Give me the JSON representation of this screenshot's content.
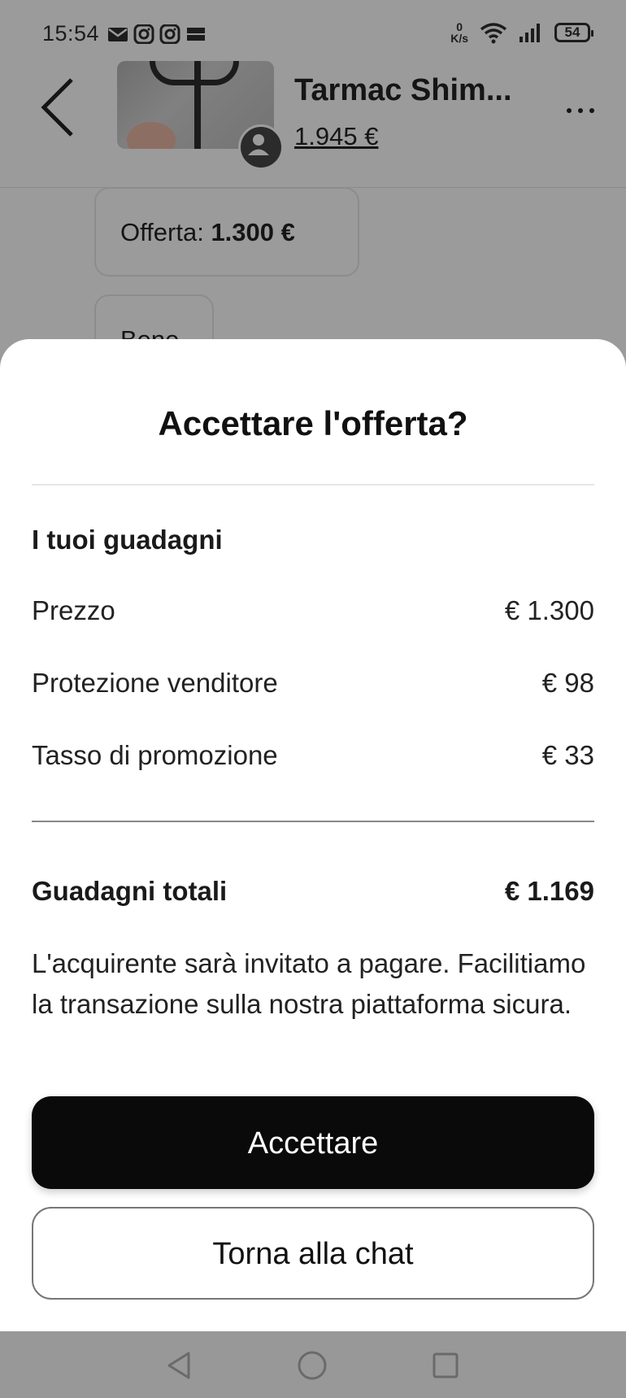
{
  "status_bar": {
    "time": "15:54",
    "notification_icons": [
      "mail-icon",
      "instagram-icon",
      "instagram-icon",
      "temu-icon"
    ],
    "network_speed_value": "0",
    "network_speed_unit": "K/s",
    "battery": "54"
  },
  "chat_header": {
    "title": "Tarmac Shim...",
    "price": "1.945 €",
    "back_icon": "chevron-left-icon",
    "more_icon": "ellipsis-icon"
  },
  "chat": {
    "offer_label": "Offerta:",
    "offer_amount": "1.300 €",
    "partial_message": "Bene"
  },
  "sheet": {
    "title": "Accettare l'offerta?",
    "section_title": "I tuoi guadagni",
    "rows": [
      {
        "label": "Prezzo",
        "value": "€ 1.300"
      },
      {
        "label": "Protezione venditore",
        "value": "€ 98"
      },
      {
        "label": "Tasso di promozione",
        "value": "€ 33"
      }
    ],
    "total": {
      "label": "Guadagni totali",
      "value": "€ 1.169"
    },
    "disclaimer": "L'acquirente sarà invitato a pagare. Facilitiamo la transazione sulla nostra piattaforma sicura.",
    "accept_label": "Accettare",
    "back_label": "Torna alla chat"
  },
  "nav_bar": {
    "items": [
      "back-triangle-icon",
      "home-circle-icon",
      "recents-square-icon"
    ]
  },
  "colors": {
    "overlay_gray": "#9b9b9b",
    "primary_button": "#0a0a0a",
    "sheet_background": "#ffffff"
  }
}
